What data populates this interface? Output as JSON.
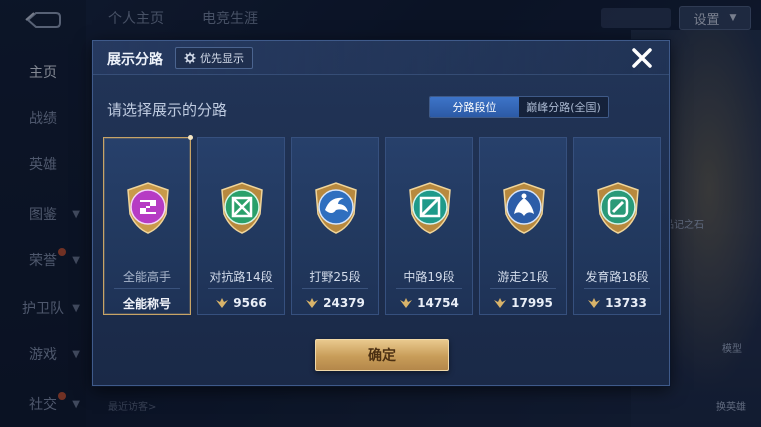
{
  "background": {
    "top_tabs": [
      "个人主页",
      "电竞生涯"
    ],
    "settings_label": "设置",
    "nav_items": [
      "主页",
      "战绩",
      "英雄",
      "图鉴",
      "荣誉",
      "护卫队",
      "游戏",
      "社交"
    ],
    "recent_visitors": "最近访客>",
    "side_labels": [
      "品记之石",
      "模型",
      "换英雄"
    ]
  },
  "dialog": {
    "title": "展示分路",
    "priority_label": "优先显示",
    "subtitle": "请选择展示的分路",
    "toggle": {
      "left": "分路段位",
      "right": "巅峰分路(全国)"
    },
    "confirm_label": "确定",
    "cards": [
      {
        "name": "全能高手",
        "foot": "全能称号",
        "emblem_color": "#b63bc4",
        "icon": "all-round-icon",
        "selected": true
      },
      {
        "name": "对抗路14段",
        "foot": "9566",
        "emblem_color": "#2aa06a",
        "icon": "clash-lane-icon",
        "selected": false
      },
      {
        "name": "打野25段",
        "foot": "24379",
        "emblem_color": "#2f6fbf",
        "icon": "jungle-icon",
        "selected": false
      },
      {
        "name": "中路19段",
        "foot": "14754",
        "emblem_color": "#1f9a8a",
        "icon": "mid-lane-icon",
        "selected": false
      },
      {
        "name": "游走21段",
        "foot": "17995",
        "emblem_color": "#2c5da8",
        "icon": "roam-icon",
        "selected": false
      },
      {
        "name": "发育路18段",
        "foot": "13733",
        "emblem_color": "#2a9a78",
        "icon": "farm-lane-icon",
        "selected": false
      }
    ]
  }
}
